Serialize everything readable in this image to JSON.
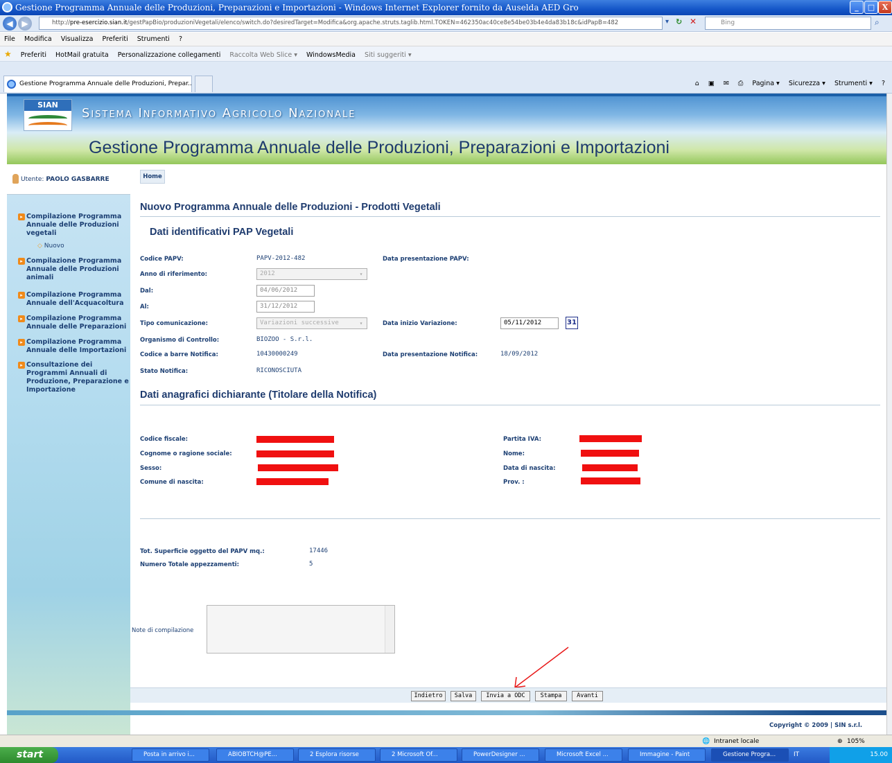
{
  "window": {
    "title": "Gestione Programma Annuale delle Produzioni, Preparazioni e Importazioni - Windows Internet Explorer fornito da Auselda AED Gro",
    "min_label": "_",
    "max_label": "□",
    "close_label": "X"
  },
  "address": {
    "prefix": "http://",
    "host": "pre-esercizio.sian.it",
    "path": "/gestPapBio/produzioniVegetali/elenco/switch.do?desiredTarget=Modifica&org.apache.struts.taglib.html.TOKEN=462350ac40ce8e54be03b4e4da83b18c&idPapB=482",
    "search_placeholder": "Bing"
  },
  "menu": [
    "File",
    "Modifica",
    "Visualizza",
    "Preferiti",
    "Strumenti",
    "?"
  ],
  "favorites": {
    "label": "Preferiti",
    "items": [
      "HotMail gratuita",
      "Personalizzazione collegamenti",
      "Raccolta Web Slice ▾",
      "WindowsMedia",
      "Siti suggeriti ▾"
    ]
  },
  "tab": {
    "title": "Gestione Programma Annuale delle Produzioni, Prepar..."
  },
  "commandbar": [
    "Pagina ▾",
    "Sicurezza ▾",
    "Strumenti ▾"
  ],
  "banner": {
    "logo_text": "SIAN",
    "system_name": "Sistema Informativo Agricolo Nazionale",
    "page_title": "Gestione Programma Annuale delle Produzioni, Preparazioni e Importazioni"
  },
  "sidebar": {
    "user_prefix": "Utente:",
    "user_name": "PAOLO GASBARRE",
    "items": [
      {
        "label": "Compilazione Programma Annuale delle Produzioni vegetali"
      },
      {
        "label": "Compilazione Programma Annuale delle Produzioni animali"
      },
      {
        "label": "Compilazione Programma Annuale dell'Acquacoltura"
      },
      {
        "label": "Compilazione Programma Annuale delle Preparazioni"
      },
      {
        "label": "Compilazione Programma Annuale delle Importazioni"
      },
      {
        "label": "Consultazione dei Programmi Annuali di Produzione, Preparazione e Importazione"
      }
    ],
    "sub_item": "Nuovo"
  },
  "main": {
    "home": "Home",
    "heading": "Nuovo Programma Annuale delle Produzioni - Prodotti Vegetali",
    "section1": "Dati identificativi PAP Vegetali",
    "fields": {
      "codice_label": "Codice PAPV:",
      "codice_value": "PAPV-2012-482",
      "data_pres_label": "Data presentazione PAPV:",
      "anno_label": "Anno di riferimento:",
      "anno_value": "2012",
      "dal_label": "Dal:",
      "dal_value": "04/06/2012",
      "al_label": "Al:",
      "al_value": "31/12/2012",
      "tipo_label": "Tipo comunicazione:",
      "tipo_value": "Variazioni successive",
      "data_var_label": "Data inizio Variazione:",
      "data_var_value": "05/11/2012",
      "cal_label": "31",
      "org_label": "Organismo di Controllo:",
      "org_value": "BIOZOO - S.r.l.",
      "barre_label": "Codice a barre Notifica:",
      "barre_value": "10430000249",
      "data_notif_label": "Data presentazione Notifica:",
      "data_notif_value": "18/09/2012",
      "stato_label": "Stato Notifica:",
      "stato_value": "RICONOSCIUTA"
    },
    "section2": "Dati anagrafici dichiarante (Titolare della Notifica)",
    "anagrafica": {
      "cf_label": "Codice fiscale:",
      "cognome_label": "Cognome o ragione sociale:",
      "sesso_label": "Sesso:",
      "comune_label": "Comune di nascita:",
      "piva_label": "Partita IVA:",
      "nome_label": "Nome:",
      "data_nascita_label": "Data di nascita:",
      "prov_label": "Prov. :"
    },
    "totals": {
      "superficie_label": "Tot. Superficie oggetto del PAPV mq.:",
      "superficie_value": "17446",
      "appezzamenti_label": "Numero Totale appezzamenti:",
      "appezzamenti_value": "5"
    },
    "notes_label": "Note di compilazione",
    "buttons": [
      "Indietro",
      "Salva",
      "Invia a ODC",
      "Stampa",
      "Avanti"
    ]
  },
  "copyright": "Copyright © 2009 | SIN s.r.l.",
  "status": {
    "zone": "Intranet locale",
    "zoom": "105%"
  },
  "taskbar": {
    "start": "start",
    "tasks": [
      "Posta in arrivo i...",
      "ABIOBTCH@PE...",
      "2 Esplora risorse",
      "2 Microsoft Of...",
      "PowerDesigner ...",
      "Microsoft Excel ...",
      "Immagine - Paint",
      "Gestione Progra..."
    ],
    "lang": "IT",
    "clock": "15.00"
  }
}
